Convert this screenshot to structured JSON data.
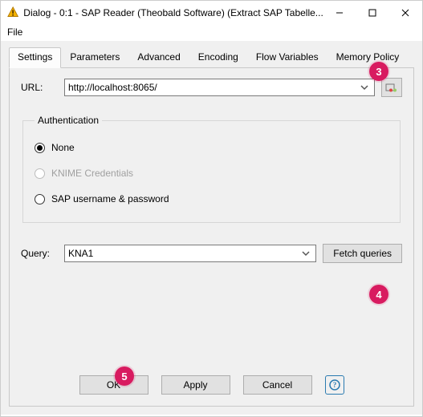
{
  "window": {
    "title": "Dialog - 0:1 - SAP Reader (Theobald Software) (Extract SAP Tabelle...",
    "controls": {
      "minimize": "–",
      "maximize": "▢",
      "close": "✕"
    }
  },
  "menubar": {
    "file": "File"
  },
  "tabs": [
    "Settings",
    "Parameters",
    "Advanced",
    "Encoding",
    "Flow Variables",
    "Memory Policy"
  ],
  "selected_tab_index": 0,
  "url": {
    "label": "URL:",
    "value": "http://localhost:8065/"
  },
  "authentication": {
    "legend": "Authentication",
    "options": {
      "none": "None",
      "knime": "KNIME Credentials",
      "sap": "SAP username & password"
    },
    "selected": "none",
    "knime_enabled": false
  },
  "query": {
    "label": "Query:",
    "value": "KNA1",
    "fetch_label": "Fetch queries"
  },
  "footer": {
    "ok": "OK",
    "apply": "Apply",
    "cancel": "Cancel"
  },
  "callouts": {
    "c3": "3",
    "c4": "4",
    "c5": "5"
  },
  "colors": {
    "accent": "#d81b60"
  }
}
